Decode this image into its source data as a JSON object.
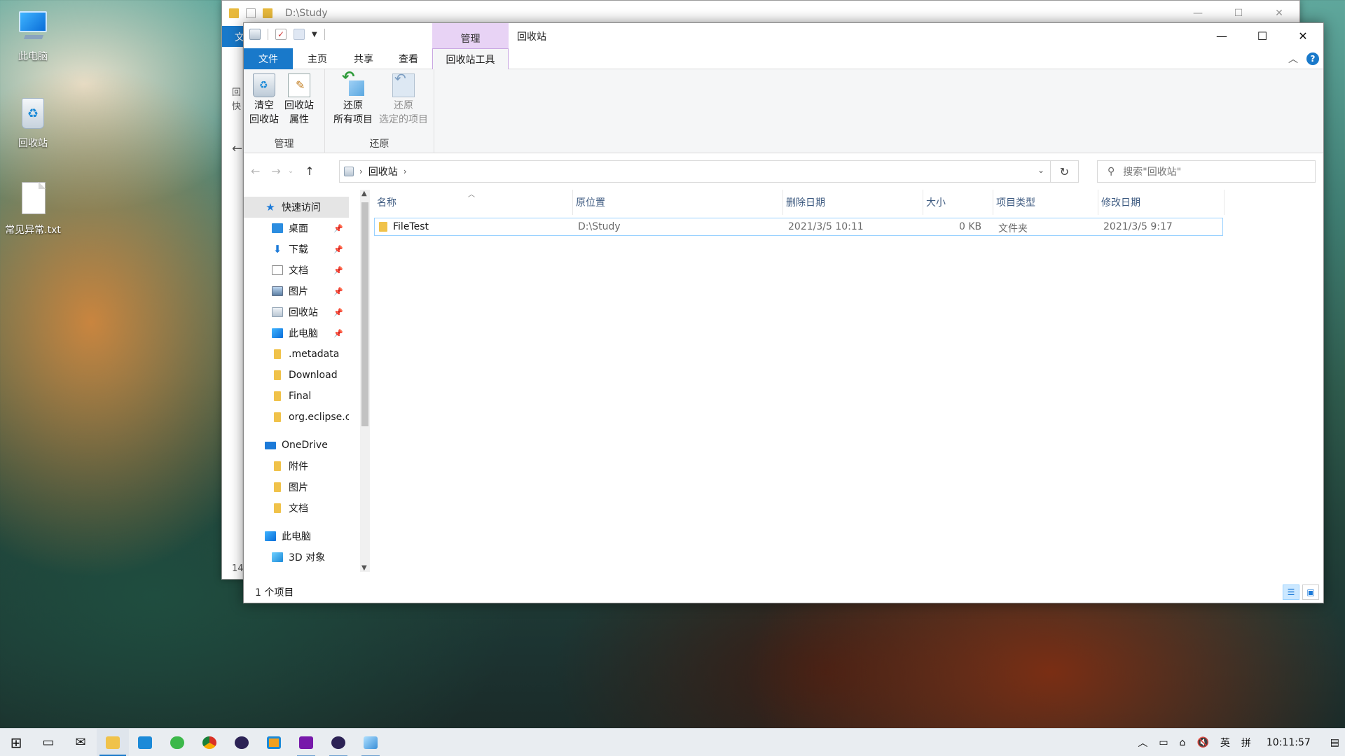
{
  "desktop": {
    "icons": [
      {
        "label": "此电脑"
      },
      {
        "label": "回收站"
      },
      {
        "label": "常见异常.txt"
      }
    ]
  },
  "back_window": {
    "path": "D:\\Study",
    "tab_partial": "文",
    "side_partial_1": "回",
    "side_partial_2": "快",
    "count_partial": "14"
  },
  "window": {
    "title": "回收站",
    "context_tab_group": "管理",
    "tabs": [
      "文件",
      "主页",
      "共享",
      "查看",
      "回收站工具"
    ],
    "controls": {
      "minimize": "—",
      "maximize": "☐",
      "close": "✕"
    }
  },
  "ribbon": {
    "groups": [
      {
        "label": "管理",
        "buttons": [
          {
            "line1": "清空",
            "line2": "回收站",
            "icon": "empty-recycle-bin-icon"
          },
          {
            "line1": "回收站",
            "line2": "属性",
            "icon": "recycle-bin-properties-icon"
          }
        ]
      },
      {
        "label": "还原",
        "buttons": [
          {
            "line1": "还原",
            "line2": "所有项目",
            "icon": "restore-all-icon"
          },
          {
            "line1": "还原",
            "line2": "选定的项目",
            "icon": "restore-selected-icon",
            "disabled": true
          }
        ]
      }
    ]
  },
  "address": {
    "crumb": "回收站",
    "search_placeholder": "搜索\"回收站\""
  },
  "navpane": {
    "quick_access": "快速访问",
    "quick_items": [
      {
        "label": "桌面",
        "pinned": true
      },
      {
        "label": "下载",
        "pinned": true
      },
      {
        "label": "文档",
        "pinned": true
      },
      {
        "label": "图片",
        "pinned": true
      },
      {
        "label": "回收站",
        "pinned": true
      },
      {
        "label": "此电脑",
        "pinned": true
      },
      {
        "label": ".metadata",
        "pinned": false
      },
      {
        "label": "Download",
        "pinned": false
      },
      {
        "label": "Final",
        "pinned": false
      },
      {
        "label": "org.eclipse.cc",
        "pinned": false
      }
    ],
    "onedrive": "OneDrive",
    "onedrive_items": [
      "附件",
      "图片",
      "文档"
    ],
    "thispc": "此电脑",
    "thispc_items": [
      "3D 对象"
    ]
  },
  "filelist": {
    "columns": [
      "名称",
      "原位置",
      "删除日期",
      "大小",
      "项目类型",
      "修改日期"
    ],
    "rows": [
      {
        "name": "FileTest",
        "original_location": "D:\\Study",
        "deleted": "2021/3/5 10:11",
        "size": "0 KB",
        "type": "文件夹",
        "modified": "2021/3/5 9:17"
      }
    ]
  },
  "status": {
    "count": "1 个项目"
  },
  "taskbar": {
    "tray": {
      "ime": "英",
      "ime2": "拼",
      "time": "10:11:57"
    }
  }
}
